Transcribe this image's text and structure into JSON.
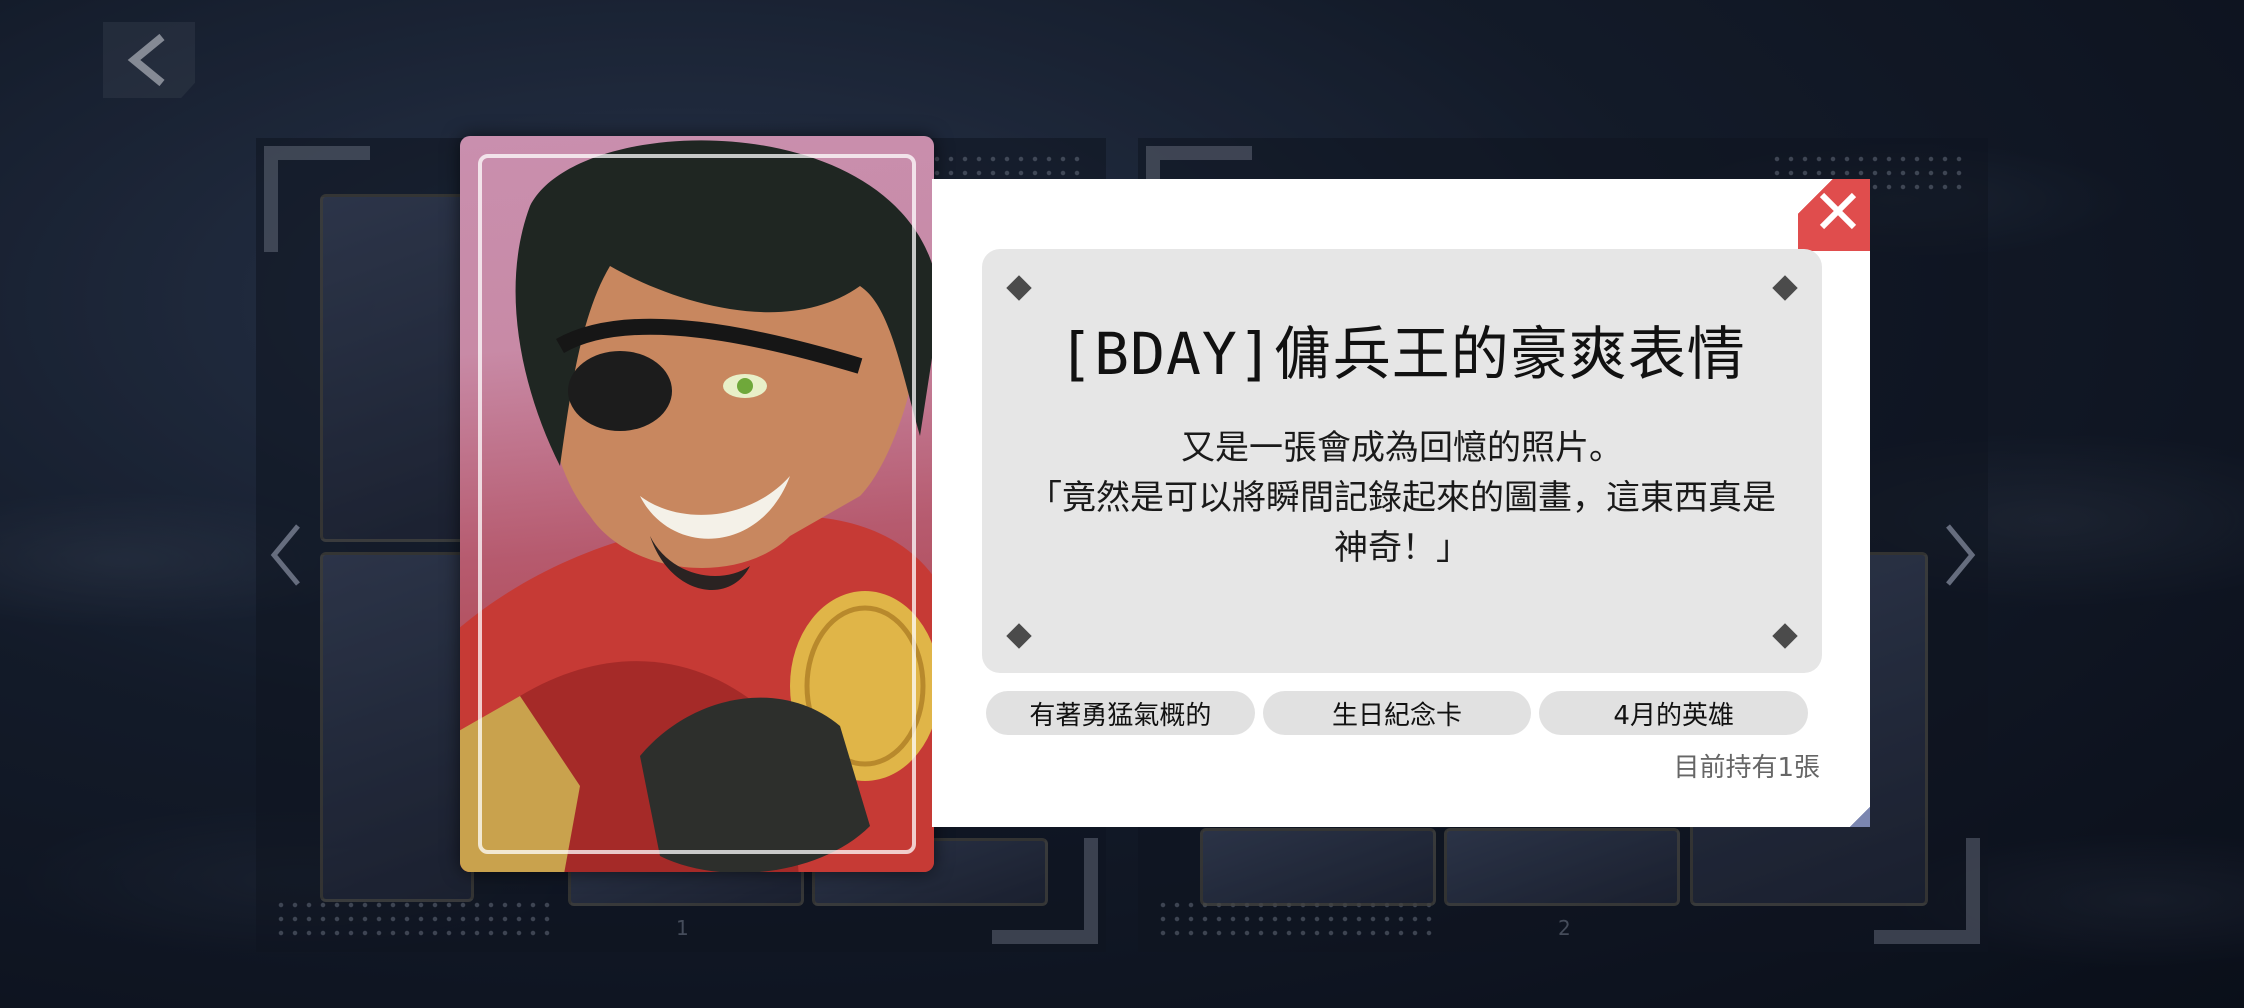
{
  "background": {
    "page_numbers": [
      "1",
      "2"
    ]
  },
  "card": {
    "title": "[BDAY]傭兵王的豪爽表情",
    "description": [
      "又是一張會成為回憶的照片。",
      "「竟然是可以將瞬間記錄起來的圖畫，這東西真是",
      "神奇！」"
    ],
    "tags": [
      "有著勇猛氣概的",
      "生日紀念卡",
      "4月的英雄"
    ],
    "owned_text": "目前持有1張"
  },
  "colors": {
    "close_button": "#e04d4d",
    "desc_box": "#e6e6e6",
    "card_bg": "#c98fae"
  },
  "icons": {
    "back": "chevron-left-icon",
    "close": "close-icon",
    "prev": "chevron-left-icon",
    "next": "chevron-right-icon"
  }
}
